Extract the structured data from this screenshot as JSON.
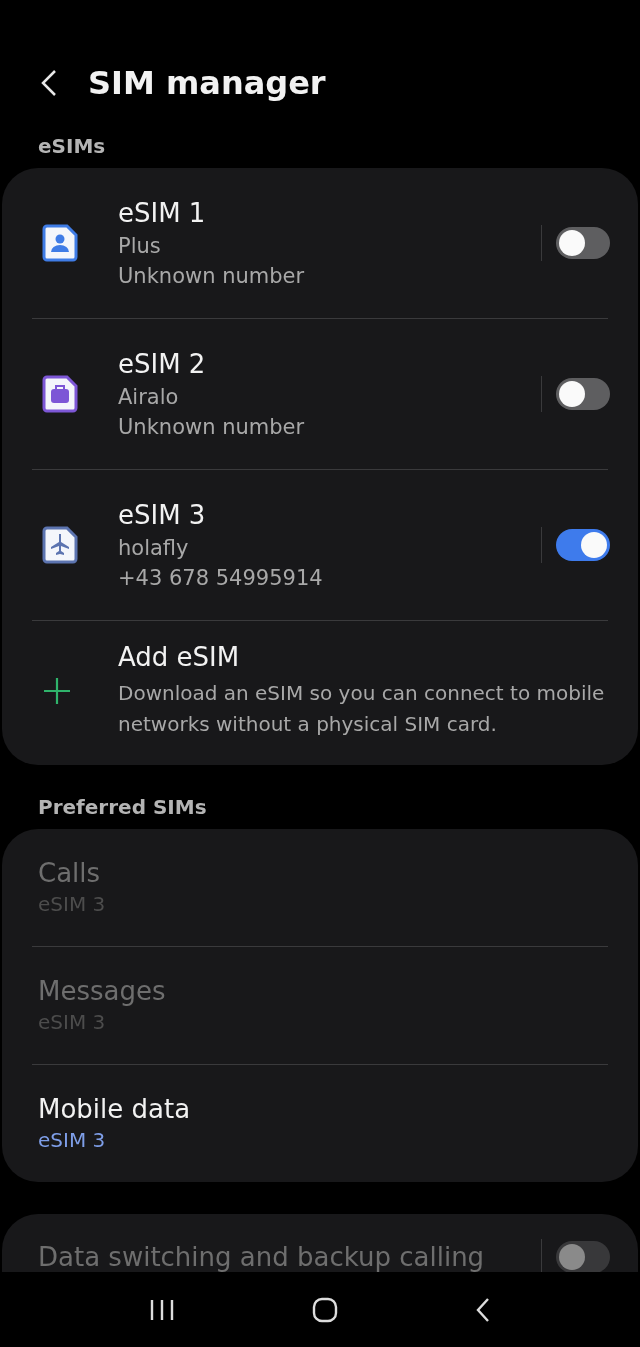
{
  "header": {
    "title": "SIM manager"
  },
  "esims": {
    "heading": "eSIMs",
    "items": [
      {
        "name": "eSIM 1",
        "carrier": "Plus",
        "number": "Unknown number",
        "kind": "person",
        "color": "#3f7ce6",
        "on": false
      },
      {
        "name": "eSIM 2",
        "carrier": "Airalo",
        "number": "Unknown number",
        "kind": "briefcase",
        "color": "#7d57d6",
        "on": false
      },
      {
        "name": "eSIM 3",
        "carrier": "holafly",
        "number": "+43 678 54995914",
        "kind": "plane",
        "color": "#5c74b0",
        "on": true
      }
    ],
    "add": {
      "title": "Add eSIM",
      "description": "Download an eSIM so you can connect to mobile networks without a physical SIM card."
    }
  },
  "preferred": {
    "heading": "Preferred SIMs",
    "items": [
      {
        "label": "Calls",
        "value": "eSIM 3",
        "disabled": true
      },
      {
        "label": "Messages",
        "value": "eSIM 3",
        "disabled": true
      },
      {
        "label": "Mobile data",
        "value": "eSIM 3",
        "disabled": false
      }
    ]
  },
  "data_switching": {
    "label": "Data switching and backup calling",
    "on": false,
    "disabled": true
  }
}
